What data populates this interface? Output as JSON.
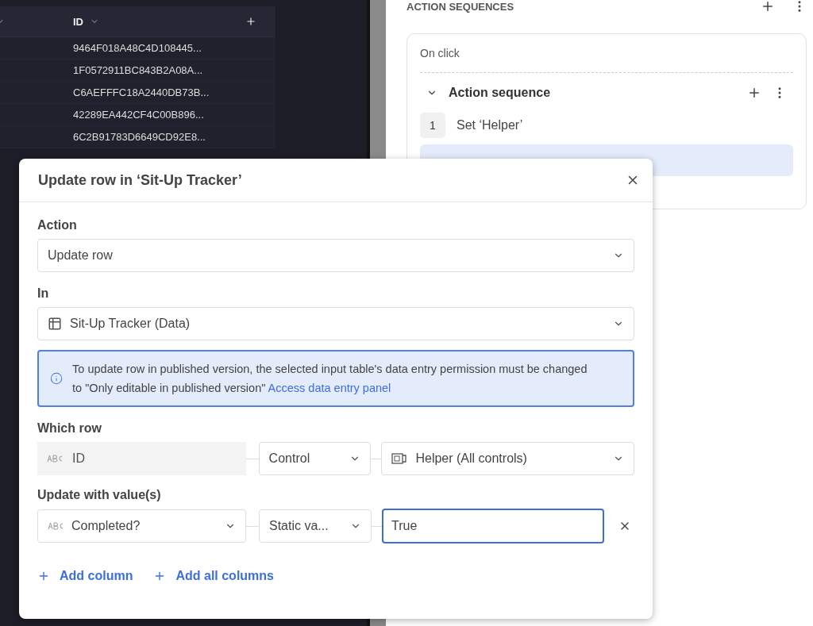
{
  "table": {
    "columns": [
      {
        "label": "ID"
      }
    ],
    "rows": [
      {
        "id": "9464F018A48C4D108445..."
      },
      {
        "id": "1F0572911BC843B2A08A..."
      },
      {
        "id": "C6AEFFFC18A2440DB73B..."
      },
      {
        "id": "42289EA442CF4C00B896..."
      },
      {
        "id": "6C2B91783D6649CD92E8..."
      }
    ]
  },
  "panel": {
    "title": "ACTION SEQUENCES",
    "trigger": "On click",
    "sequence": {
      "title": "Action sequence",
      "expanded": true,
      "steps": [
        {
          "number": "1",
          "label": "Set ‘Helper’",
          "selected": false
        },
        {
          "selected": true
        }
      ]
    }
  },
  "dialog": {
    "title": "Update row in ‘Sit-Up Tracker’",
    "action": {
      "label": "Action",
      "value": "Update row"
    },
    "in": {
      "label": "In",
      "value": "Sit-Up Tracker (Data)"
    },
    "info": {
      "text": "To update row in published version, the selected input table's data entry permission must be changed to \"Only editable in published version\"",
      "link": "Access data entry panel"
    },
    "which_row": {
      "label": "Which row",
      "column": "ID",
      "source": "Control",
      "value": "Helper (All controls)"
    },
    "update": {
      "label": "Update with value(s)",
      "column": "Completed?",
      "source": "Static va...",
      "value": "True",
      "focused": true
    },
    "links": [
      "Add column",
      "Add all columns"
    ]
  }
}
